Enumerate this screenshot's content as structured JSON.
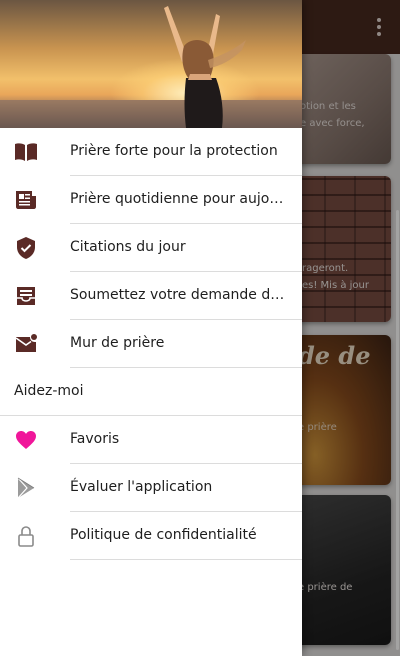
{
  "colors": {
    "appbar": "#4a2a20",
    "drawer_icon": "#5a2a26",
    "favorite_heart": "#f0169a",
    "muted_icon": "#8a8a8a"
  },
  "background_cards": [
    {
      "text": "otion et les\ne avec force,"
    },
    {
      "text": "rageront.\nes! Mis à jour"
    },
    {
      "title": "de de",
      "text": "e prière"
    },
    {
      "text": "e prière de"
    }
  ],
  "drawer": {
    "items": [
      {
        "label": "Prière forte pour la protection",
        "icon": "book-icon"
      },
      {
        "label": "Prière quotidienne pour aujourd'hui",
        "icon": "newspaper-icon"
      },
      {
        "label": "Citations du jour",
        "icon": "verified-shield-icon"
      },
      {
        "label": "Soumettez votre demande de prière",
        "icon": "inbox-tray-icon"
      },
      {
        "label": "Mur de prière",
        "icon": "mail-notification-icon"
      }
    ],
    "section_header": "Aidez-moi",
    "help_items": [
      {
        "label": "Favoris",
        "icon": "heart-icon"
      },
      {
        "label": "Évaluer l'application",
        "icon": "play-store-icon"
      },
      {
        "label": "Politique de confidentialité",
        "icon": "lock-icon"
      }
    ]
  }
}
